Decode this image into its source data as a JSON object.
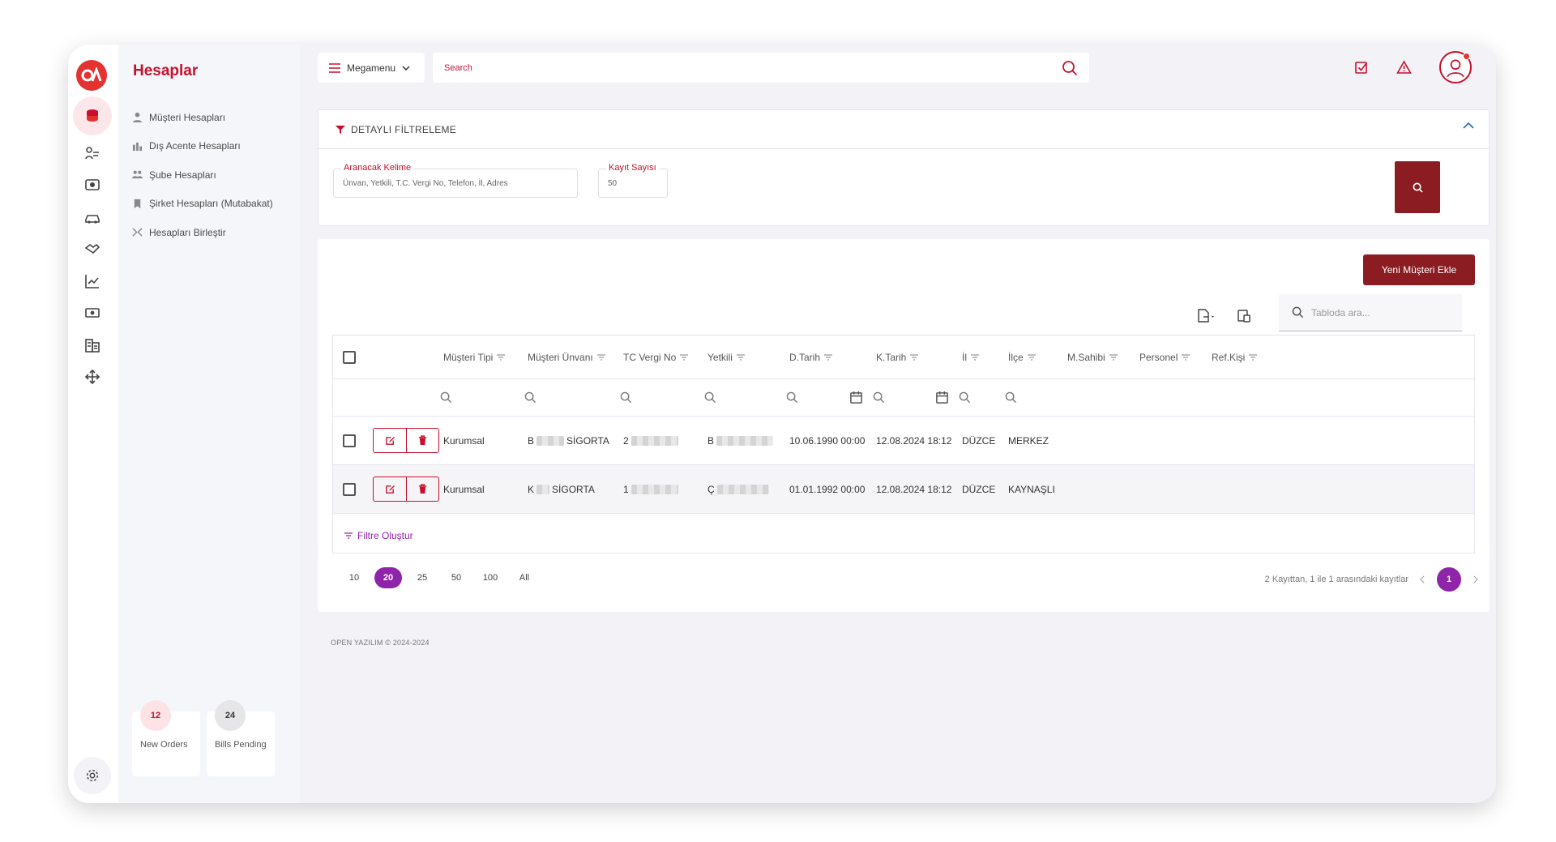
{
  "subpanel": {
    "title": "Hesaplar",
    "items": [
      {
        "label": "Müşteri Hesapları",
        "icon": "user-icon"
      },
      {
        "label": "Dış Acente Hesapları",
        "icon": "chart-bars-icon"
      },
      {
        "label": "Şube Hesapları",
        "icon": "group-icon"
      },
      {
        "label": "Şirket Hesapları (Mutabakat)",
        "icon": "bookmark-icon"
      },
      {
        "label": "Hesapları Birleştir",
        "icon": "merge-icon"
      }
    ]
  },
  "stats": [
    {
      "count": "12",
      "label": "New Orders",
      "bg": "#fde3e6",
      "fg": "#c8102e"
    },
    {
      "count": "24",
      "label": "Bills Pending",
      "bg": "#e6e6e9",
      "fg": "#333333"
    }
  ],
  "topbar": {
    "megamenu_label": "Megamenu",
    "search_placeholder": "Search"
  },
  "filter": {
    "title": "DETAYLI FİLTRELEME",
    "keyword_label": "Aranacak Kelime",
    "keyword_placeholder": "Ünvan, Yetkili, T.C. Vergi No, Telefon, İl, Adres",
    "count_label": "Kayıt Sayısı",
    "count_value": "50"
  },
  "table": {
    "new_button": "Yeni Müşteri Ekle",
    "search_placeholder": "Tabloda ara...",
    "columns": [
      "Müşteri Tipi",
      "Müşteri Ünvanı",
      "TC Vergi No",
      "Yetkili",
      "D.Tarih",
      "K.Tarih",
      "İl",
      "İlçe",
      "M.Sahibi",
      "Personel",
      "Ref.Kişi"
    ],
    "rows": [
      {
        "tipi": "Kurumsal",
        "unvan_start": "B",
        "unvan_end": "SİGORTA",
        "tc_start": "2",
        "yetkili_start": "B",
        "dtarih": "10.06.1990 00:00",
        "ktarih": "12.08.2024 18:12",
        "il": "DÜZCE",
        "ilce": "MERKEZ"
      },
      {
        "tipi": "Kurumsal",
        "unvan_start": "K",
        "unvan_end": "SİGORTA",
        "tc_start": "1",
        "yetkili_start": "Ç",
        "dtarih": "01.01.1992 00:00",
        "ktarih": "12.08.2024 18:12",
        "il": "DÜZCE",
        "ilce": "KAYNAŞLI"
      }
    ],
    "filter_create": "Filtre Oluştur"
  },
  "pager": {
    "sizes": [
      "10",
      "20",
      "25",
      "50",
      "100",
      "All"
    ],
    "selected": "20",
    "info": "2 Kayıttan, 1 ile 1 arasındaki kayıtlar",
    "current_page": "1"
  },
  "footer": "OPEN YAZILIM © 2024-2024",
  "colors": {
    "brand": "#c8102e",
    "dark_brand": "#8b1c22",
    "accent": "#8e24aa"
  }
}
